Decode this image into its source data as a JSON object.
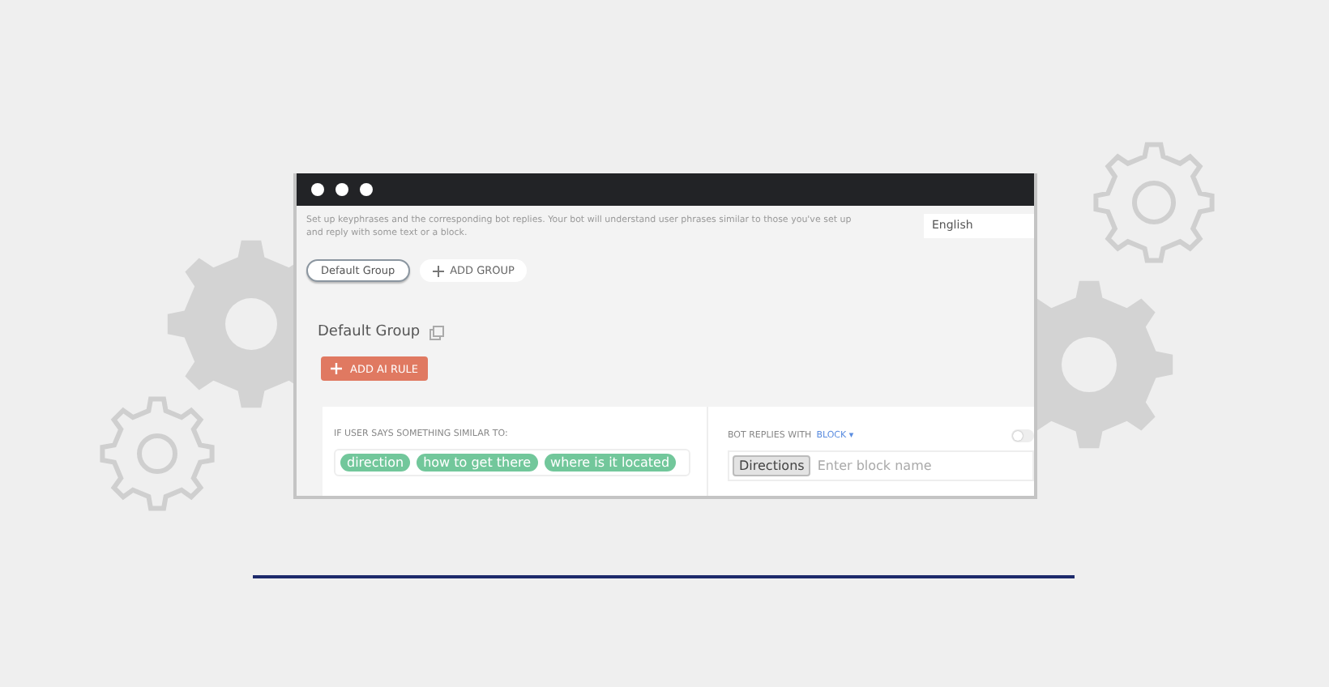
{
  "window": {
    "description": "Set up keyphrases and the corresponding bot replies. Your bot will understand user phrases similar to those you've set up and reply with some text or a block.",
    "language": "English",
    "groups": [
      {
        "label": "Default Group",
        "selected": true
      }
    ],
    "add_group_button": "ADD GROUP",
    "group_title": "Default Group",
    "add_rule_button": "ADD AI RULE",
    "rule": {
      "user_says_label": "IF USER SAYS SOMETHING SIMILAR TO:",
      "phrases": [
        "direction",
        "how to get there",
        "where is it located"
      ],
      "bot_replies_label": "BOT REPLIES WITH",
      "reply_type": "BLOCK",
      "reply_caret": "▾",
      "toggle": {
        "on": false
      },
      "blocks": [
        "Directions"
      ],
      "block_placeholder": "Enter block name"
    }
  }
}
